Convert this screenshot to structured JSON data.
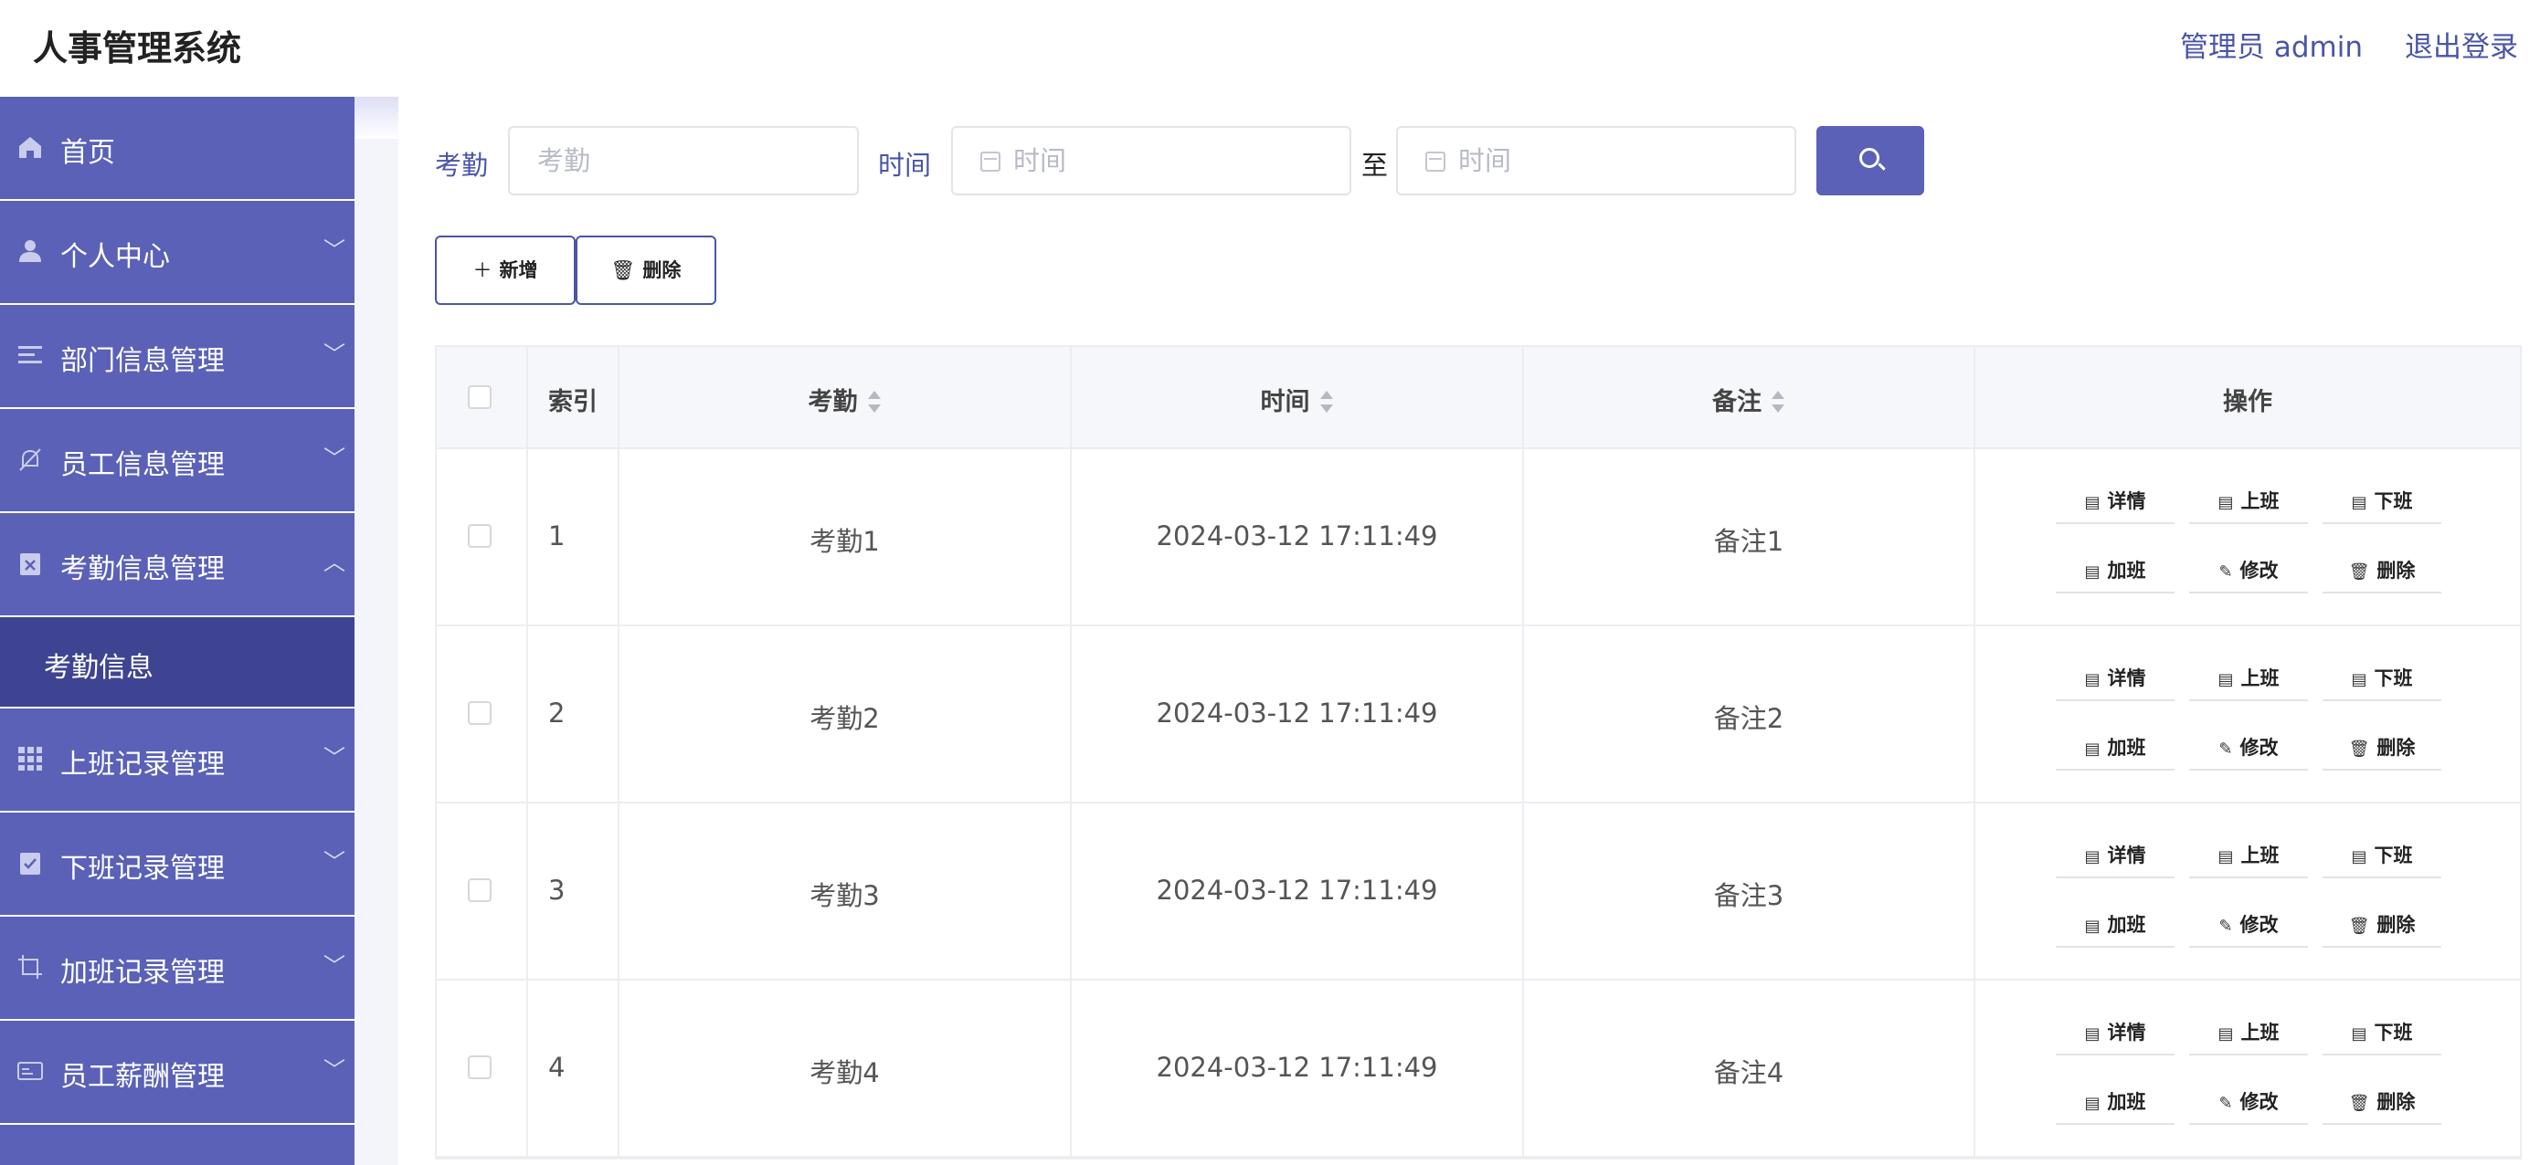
{
  "header": {
    "title": "人事管理系统",
    "user_label": "管理员 admin",
    "logout_label": "退出登录"
  },
  "sidebar": {
    "items": [
      {
        "label": "首页",
        "icon": "home-icon",
        "expanded": false
      },
      {
        "label": "个人中心",
        "icon": "user-icon",
        "expanded": false
      },
      {
        "label": "部门信息管理",
        "icon": "list-icon",
        "expanded": false
      },
      {
        "label": "员工信息管理",
        "icon": "bell-off-icon",
        "expanded": false
      },
      {
        "label": "考勤信息管理",
        "icon": "clipboard-x-icon",
        "expanded": true
      },
      {
        "label": "上班记录管理",
        "icon": "grid-icon",
        "expanded": false
      },
      {
        "label": "下班记录管理",
        "icon": "clipboard-check-icon",
        "expanded": false
      },
      {
        "label": "加班记录管理",
        "icon": "crop-icon",
        "expanded": false
      },
      {
        "label": "员工薪酬管理",
        "icon": "card-icon",
        "expanded": false
      }
    ],
    "submenu": {
      "label": "考勤信息"
    }
  },
  "search": {
    "kaoqin_label": "考勤",
    "kaoqin_placeholder": "考勤",
    "time_label": "时间",
    "time_start_placeholder": "时间",
    "to_label": "至",
    "time_end_placeholder": "时间",
    "button_icon": "search-icon"
  },
  "actions": {
    "add_label": "新增",
    "delete_label": "删除"
  },
  "table": {
    "columns": {
      "index": "索引",
      "kaoqin": "考勤",
      "time": "时间",
      "remark": "备注",
      "ops": "操作"
    },
    "op_labels": {
      "detail": "详情",
      "shangban": "上班",
      "xiaban": "下班",
      "jiaban": "加班",
      "edit": "修改",
      "delete": "删除"
    },
    "rows": [
      {
        "index": "1",
        "kaoqin": "考勤1",
        "time": "2024-03-12 17:11:49",
        "remark": "备注1"
      },
      {
        "index": "2",
        "kaoqin": "考勤2",
        "time": "2024-03-12 17:11:49",
        "remark": "备注2"
      },
      {
        "index": "3",
        "kaoqin": "考勤3",
        "time": "2024-03-12 17:11:49",
        "remark": "备注3"
      },
      {
        "index": "4",
        "kaoqin": "考勤4",
        "time": "2024-03-12 17:11:49",
        "remark": "备注4"
      }
    ]
  },
  "colors": {
    "brand": "#5a61b6",
    "brand_dark": "#3e4491",
    "link": "#4a55a8"
  }
}
